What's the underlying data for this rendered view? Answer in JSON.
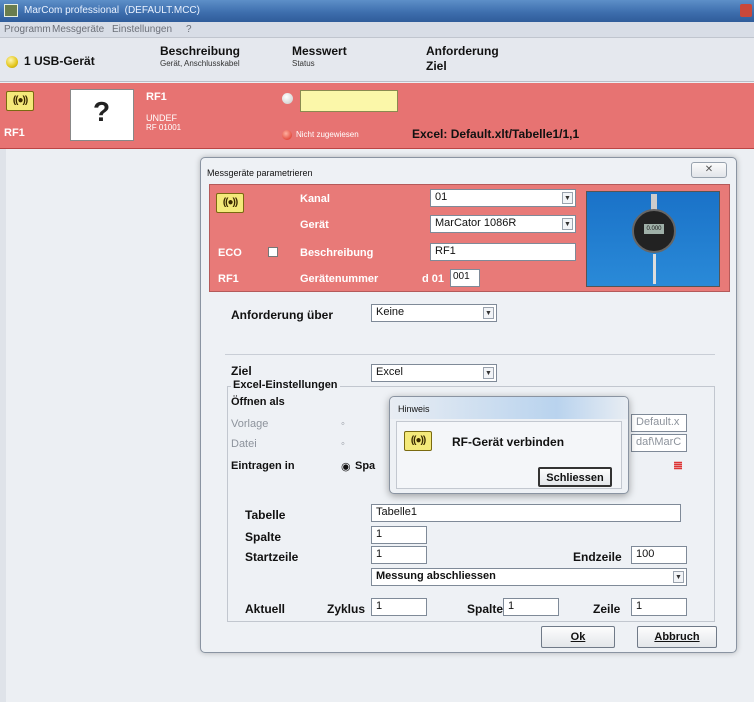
{
  "titlebar": {
    "app_title": "MarCom professional",
    "file": "(DEFAULT.MCC)"
  },
  "menu": {
    "items": [
      "Programm",
      "Messgeräte",
      "Einstellungen",
      "?"
    ]
  },
  "header": {
    "device_count": "1 USB-Gerät",
    "col1_title": "Beschreibung",
    "col1_sub": "Gerät, Anschlusskabel",
    "col2_title": "Messwert",
    "col2_sub": "Status",
    "col3_title": "Anforderung",
    "col3_sub": "Ziel"
  },
  "device_row": {
    "signal_icon_text": "((●))",
    "name": "RF1",
    "question_mark": "?",
    "description": "RF1",
    "type": "UNDEF",
    "serial": "RF 01001",
    "status": "Nicht zugewiesen",
    "target": "Excel: Default.xlt/Tabelle1/1,1"
  },
  "dialog": {
    "title": "Messgeräte parametrieren",
    "close": "✕",
    "kanal_label": "Kanal",
    "kanal_value": "01",
    "geraet_label": "Gerät",
    "geraet_value": "MarCator 1086R",
    "eco_label": "ECO",
    "beschreibung_label": "Beschreibung",
    "beschreibung_value": "RF1",
    "rf_label": "RF1",
    "geraetenummer_label": "Gerätenummer",
    "geraetenummer_prefix": "d 01",
    "geraetenummer_value": "001",
    "anforderung_label": "Anforderung über",
    "anforderung_value": "Keine",
    "ziel_label": "Ziel",
    "ziel_value": "Excel",
    "excel_group": "Excel-Einstellungen",
    "oeffnen_label": "Öffnen als",
    "vorlage_label": "Vorlage",
    "vorlage_value": "Default.x",
    "datei_label": "Datei",
    "datei_value": "daf\\MarC",
    "eintragen_label": "Eintragen in",
    "eintragen_value": "Spa",
    "tabelle_label": "Tabelle",
    "tabelle_value": "Tabelle1",
    "spalte_label": "Spalte",
    "spalte_value": "1",
    "startzeile_label": "Startzeile",
    "startzeile_value": "1",
    "endzeile_label": "Endzeile",
    "endzeile_value": "100",
    "mode_value": "Messung abschliessen",
    "aktuell_label": "Aktuell",
    "zyklus_label": "Zyklus",
    "zyklus_value": "1",
    "spalte2_label": "Spalte",
    "spalte2_value": "1",
    "zeile_label": "Zeile",
    "zeile_value": "1",
    "ok_label": "Ok",
    "abbruch_label": "Abbruch",
    "gauge_display": "0.000"
  },
  "hint": {
    "title": "Hinweis",
    "message": "RF-Gerät verbinden",
    "button": "Schliessen"
  },
  "colors": {
    "red_row": "#e77372",
    "dialog_bg": "#eef1f5",
    "accent": "#3e6fae"
  }
}
